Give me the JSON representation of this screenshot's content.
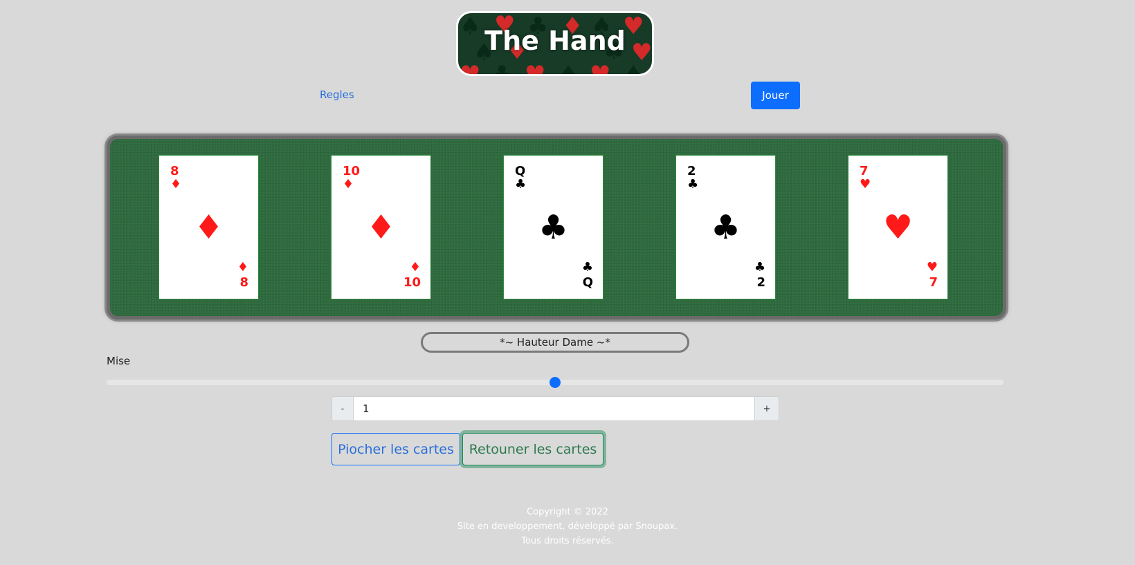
{
  "logo": {
    "title": "The Hand"
  },
  "nav": {
    "rules_link": "Regles",
    "play_button": "Jouer"
  },
  "table": {
    "cards": [
      {
        "rank": "8",
        "suit": "♦",
        "suit_name": "diamonds",
        "color": "#ff1a1a"
      },
      {
        "rank": "10",
        "suit": "♦",
        "suit_name": "diamonds",
        "color": "#ff1a1a"
      },
      {
        "rank": "Q",
        "suit": "♣",
        "suit_name": "clubs",
        "color": "#000000"
      },
      {
        "rank": "2",
        "suit": "♣",
        "suit_name": "clubs",
        "color": "#000000"
      },
      {
        "rank": "7",
        "suit": "♥",
        "suit_name": "hearts",
        "color": "#ff1a1a"
      }
    ]
  },
  "result": {
    "text": "*~ Hauteur Dame ~*"
  },
  "bet": {
    "label": "Mise",
    "slider_fraction": 0.5,
    "value": "1",
    "minus_label": "-",
    "plus_label": "+"
  },
  "actions": {
    "draw_label": "Piocher les cartes",
    "flip_label": "Retouner les cartes"
  },
  "footer": {
    "line1": "Copyright © 2022",
    "line2": "Site en developpement, développé par Snoupax.",
    "line3": "Tous droits réservés."
  },
  "colors": {
    "accent": "#0d6efd",
    "success": "#198754",
    "felt": "#2e6a3e"
  }
}
